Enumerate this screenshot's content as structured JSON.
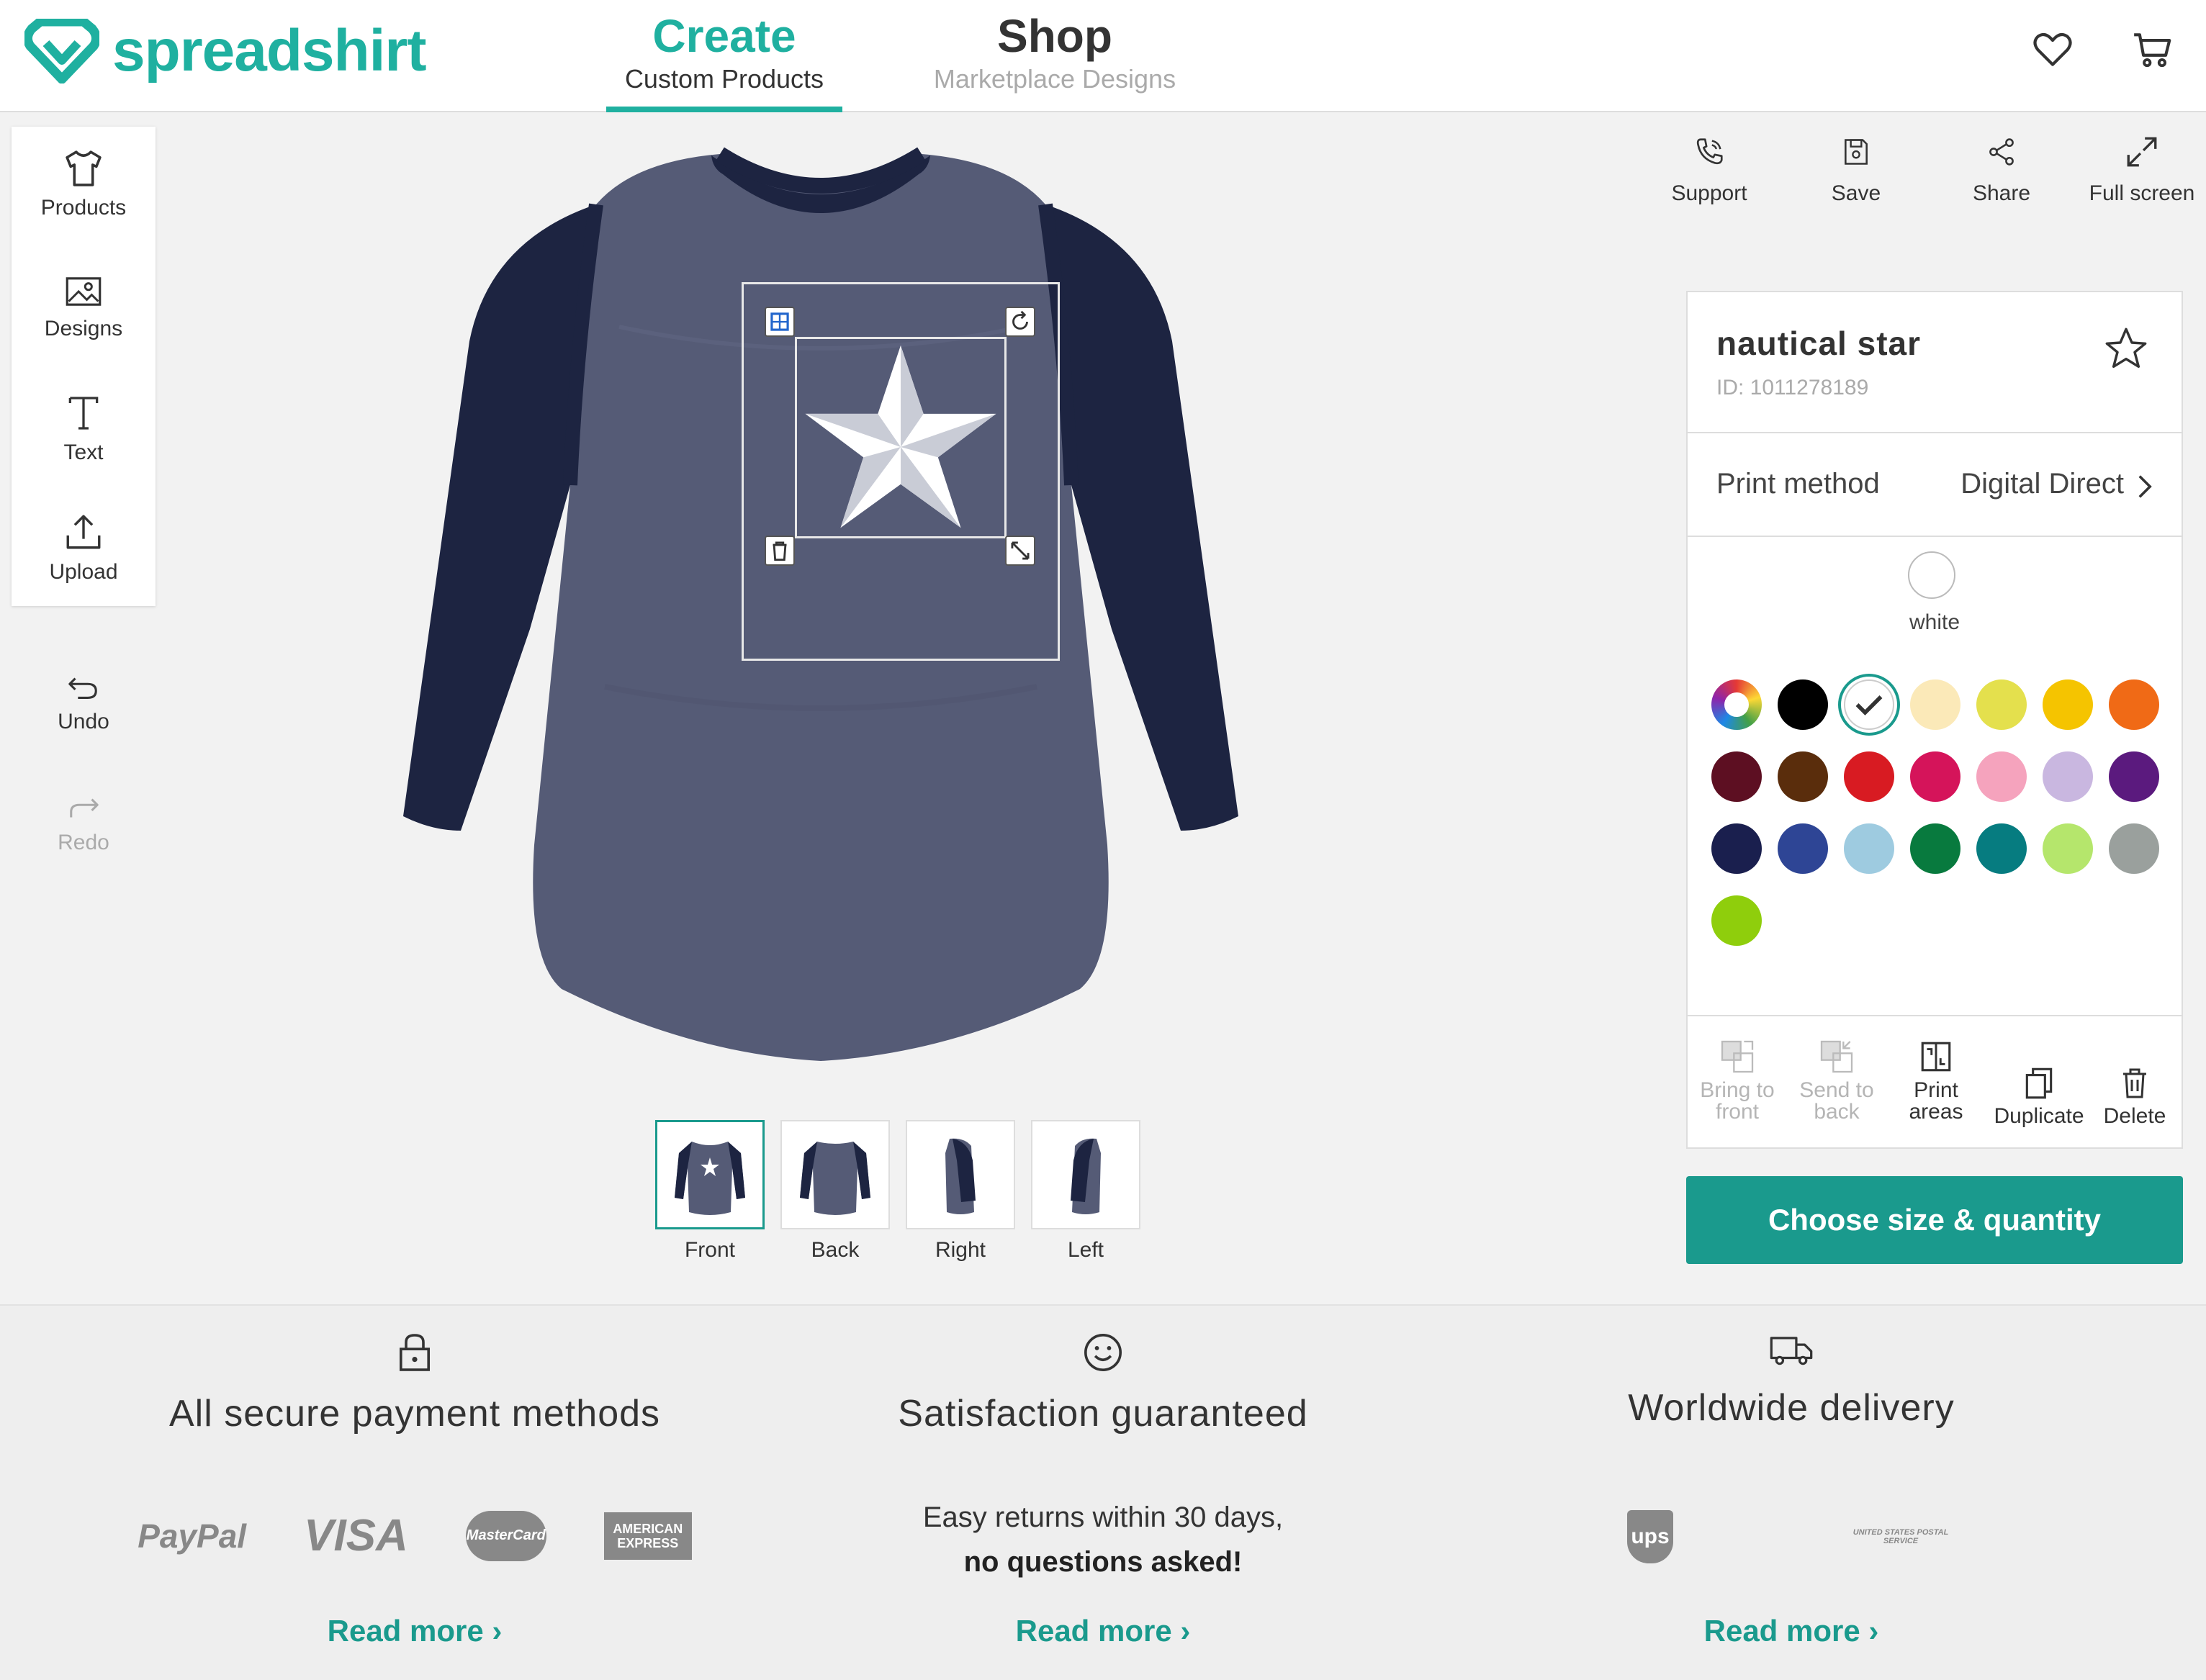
{
  "brand": {
    "name": "spreadshirt",
    "accent": "#1fb0a0",
    "cta_color": "#1a9a8d"
  },
  "nav": {
    "create": {
      "title": "Create",
      "subtitle": "Custom Products"
    },
    "shop": {
      "title": "Shop",
      "subtitle": "Marketplace Designs"
    }
  },
  "header_icons": [
    "heart-icon",
    "cart-icon"
  ],
  "left_tools": {
    "products": "Products",
    "designs": "Designs",
    "text": "Text",
    "upload": "Upload",
    "undo": "Undo",
    "redo": "Redo"
  },
  "right_actions": {
    "support": "Support",
    "save": "Save",
    "share": "Share",
    "fullscreen": "Full screen"
  },
  "views": [
    {
      "label": "Front",
      "active": true
    },
    {
      "label": "Back",
      "active": false
    },
    {
      "label": "Right",
      "active": false
    },
    {
      "label": "Left",
      "active": false
    }
  ],
  "panel": {
    "design_name": "nautical star",
    "design_id": "ID: 1011278189",
    "print_method_label": "Print method",
    "print_method_value": "Digital Direct",
    "current_color_name": "white",
    "colors": [
      "multicolor",
      "#000000",
      "#ffffff",
      "#fbe9b8",
      "#e4e04d",
      "#f5c400",
      "#f06a16",
      "#5d0f22",
      "#5a2d0c",
      "#d81b22",
      "#d5145a",
      "#f5a3bd",
      "#c9b7e0",
      "#5b1a7e",
      "#1a1f4e",
      "#2e4595",
      "#9ecbe0",
      "#087a3e",
      "#067c80",
      "#b5e66c",
      "#9aa09d",
      "#8fce0c"
    ],
    "selected_color_index": 2,
    "tools": {
      "bring_front_1": "Bring to",
      "bring_front_2": "front",
      "send_back_1": "Send to",
      "send_back_2": "back",
      "print_areas_1": "Print",
      "print_areas_2": "areas",
      "duplicate": "Duplicate",
      "delete": "Delete"
    },
    "cta": "Choose size & quantity"
  },
  "footer": {
    "payment": {
      "title": "All secure payment methods",
      "logos": [
        "PayPal",
        "VISA",
        "MasterCard",
        "AMERICAN EXPRESS"
      ],
      "read_more": "Read more"
    },
    "satisfaction": {
      "title": "Satisfaction guaranteed",
      "line1": "Easy returns within 30 days,",
      "line2": "no questions asked!",
      "read_more": "Read more"
    },
    "delivery": {
      "title": "Worldwide delivery",
      "logos": [
        "ups",
        "UNITED STATES POSTAL SERVICE"
      ],
      "read_more": "Read more"
    }
  }
}
